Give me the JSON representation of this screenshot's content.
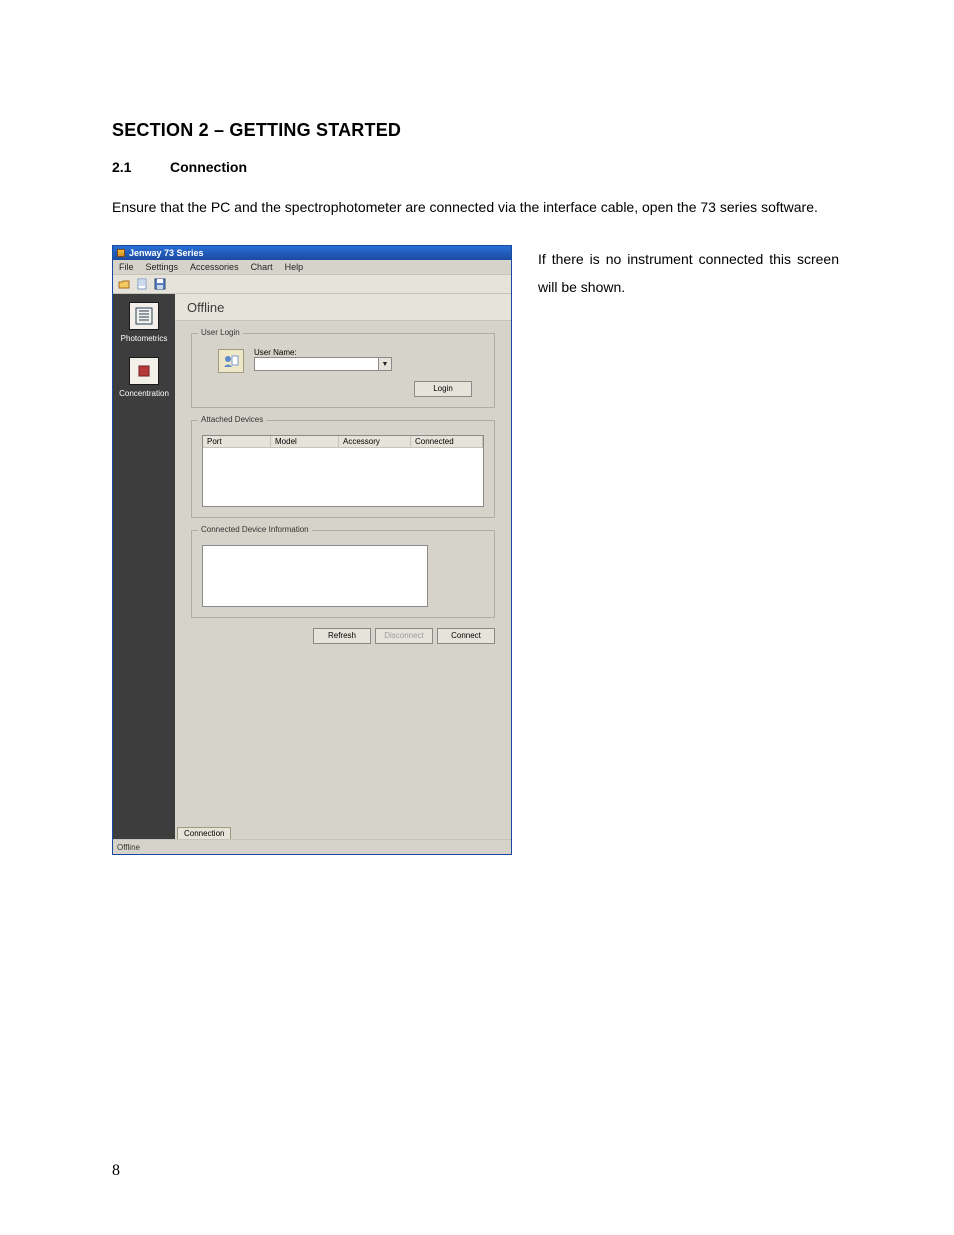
{
  "page_number": "8",
  "section_title": "SECTION 2 – GETTING STARTED",
  "subsection": {
    "num": "2.1",
    "title": "Connection"
  },
  "intro_text": "Ensure that the PC and the spectrophotometer are connected via the interface cable, open the 73 series software.",
  "side_text": "If there is no instrument connected this screen will be shown.",
  "app": {
    "title": "Jenway 73 Series",
    "menu": {
      "file": "File",
      "settings": "Settings",
      "accessories": "Accessories",
      "chart": "Chart",
      "help": "Help"
    },
    "sidebar": {
      "photometrics": "Photometrics",
      "concentration": "Concentration"
    },
    "content_header": "Offline",
    "user_login": {
      "legend": "User Login",
      "username_label": "User Name:",
      "login_btn": "Login"
    },
    "attached_devices": {
      "legend": "Attached Devices",
      "columns": {
        "port": "Port",
        "model": "Model",
        "accessory": "Accessory",
        "connected": "Connected"
      }
    },
    "connected_info": {
      "legend": "Connected Device Information"
    },
    "buttons": {
      "refresh": "Refresh",
      "disconnect": "Disconnect",
      "connect": "Connect"
    },
    "tab_connection": "Connection",
    "status": "Offline"
  }
}
